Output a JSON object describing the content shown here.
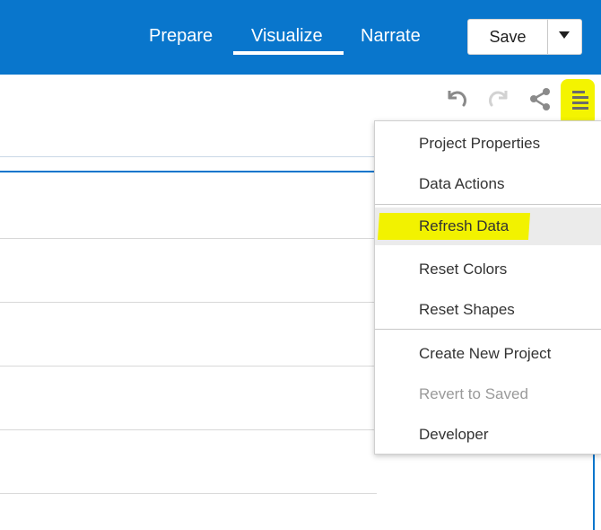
{
  "header": {
    "tabs": [
      {
        "label": "Prepare"
      },
      {
        "label": "Visualize",
        "active": true
      },
      {
        "label": "Narrate"
      }
    ],
    "save_label": "Save"
  },
  "toolbar": {
    "icons": [
      "undo-icon",
      "redo-icon",
      "share-icon",
      "hamburger-menu-icon"
    ]
  },
  "menu": {
    "items": [
      {
        "label": "Project Properties",
        "enabled": true
      },
      {
        "label": "Data Actions",
        "enabled": true
      },
      {
        "label": "Refresh Data",
        "enabled": true,
        "hovered": true
      },
      {
        "label": "Reset Colors",
        "enabled": true
      },
      {
        "label": "Reset Shapes",
        "enabled": true
      },
      {
        "label": "Create New Project",
        "enabled": true
      },
      {
        "label": "Revert to Saved",
        "enabled": false
      },
      {
        "label": "Developer",
        "enabled": true
      }
    ]
  },
  "colors": {
    "header_bg": "#0976cc",
    "highlight_marker": "#f4f400",
    "disabled_text": "#9a9a9a"
  }
}
